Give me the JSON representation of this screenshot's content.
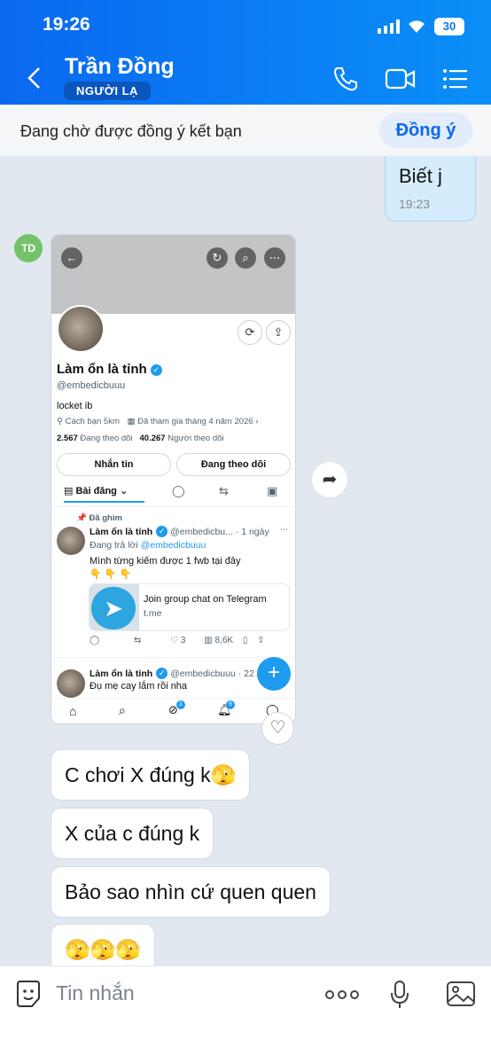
{
  "status": {
    "time": "19:26",
    "battery": "30"
  },
  "header": {
    "name": "Trần Đồng",
    "badge": "NGƯỜI LẠ"
  },
  "pending": {
    "text": "Đang chờ được đồng ý kết bạn",
    "accept_label": "Đồng ý"
  },
  "own_message": {
    "text": "Biết j",
    "time": "19:23"
  },
  "sender_avatar": "TD",
  "card": {
    "profile_name": "Làm ổn là tỉnh",
    "handle": "@embedicbuuu",
    "bio": "locket ib",
    "distance": "Cách bạn 5km",
    "joined": "Đã tham gia tháng 4 năm 2026",
    "following_count": "2.567",
    "following_label": "Đang theo dõi",
    "followers_count": "40.267",
    "followers_label": "Người theo dõi",
    "message_button": "Nhắn tin",
    "following_button": "Đang theo dõi",
    "tab_posts": "Bài đăng",
    "pinned": "Đã ghim",
    "post1": {
      "name": "Làm ổn là tỉnh",
      "handle": "@embedicbu...",
      "time": "· 1 ngày",
      "reply_to_label": "Đang trả lời",
      "reply_to_handle": "@embedicbuuu",
      "text": "Mình từng kiếm được 1 fwb tại đây",
      "emojis": "👇 👇 👇",
      "link_title": "Join group chat on Telegram",
      "link_domain": "t.me",
      "likes": "3",
      "views": "8,6K"
    },
    "post2": {
      "name": "Làm ổn là tỉnh",
      "handle": "@embedicbuuu",
      "time": "· 22 giờ",
      "text": "Đụ mẹ cay lắm rồi nha"
    },
    "nav_badge_1": "1",
    "nav_badge_2": "9"
  },
  "messages": [
    {
      "text": "C chơi X đúng k🫣"
    },
    {
      "text": "X của c đúng k"
    },
    {
      "text": "Bảo sao nhìn cứ quen quen"
    },
    {
      "text": "🫣🫣🫣"
    }
  ],
  "input": {
    "placeholder": "Tin nhắn"
  }
}
